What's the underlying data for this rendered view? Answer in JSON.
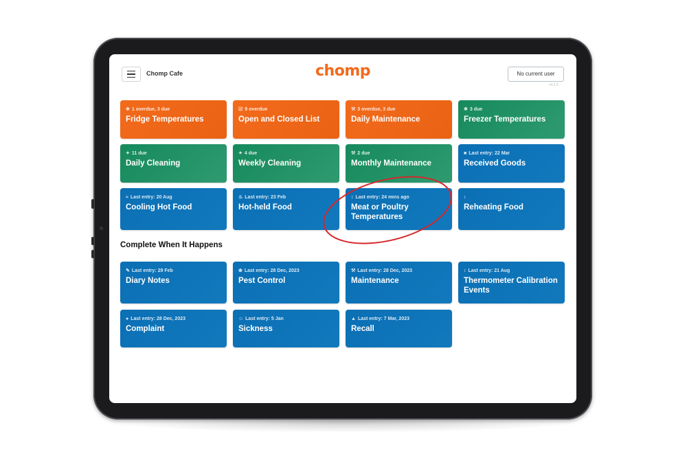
{
  "header": {
    "cafe_name": "Chomp Cafe",
    "logo": "chomp",
    "user_button": "No current user",
    "version": "v4.2.0"
  },
  "colors": {
    "orange": "#f26a1b",
    "green": "#168a5c",
    "blue": "#0b6fb4",
    "annotation": "#d7262a"
  },
  "scheduled_tasks": [
    {
      "status": "1 overdue, 3 due",
      "title": "Fridge Temperatures",
      "icon": "snowflake-icon",
      "color": "orange"
    },
    {
      "status": "9 overdue",
      "title": "Open and Closed List",
      "icon": "checkbox-icon",
      "color": "orange"
    },
    {
      "status": "3 overdue, 3 due",
      "title": "Daily Maintenance",
      "icon": "wrench-icon",
      "color": "orange"
    },
    {
      "status": "3 due",
      "title": "Freezer Temperatures",
      "icon": "snowflake-icon",
      "color": "green"
    },
    {
      "status": "11 due",
      "title": "Daily Cleaning",
      "icon": "sparkle-icon",
      "color": "green"
    },
    {
      "status": "4 due",
      "title": "Weekly Cleaning",
      "icon": "sparkle-icon",
      "color": "green"
    },
    {
      "status": "2 due",
      "title": "Monthly Maintenance",
      "icon": "wrench-icon",
      "color": "green"
    },
    {
      "status": "Last entry: 22 Mar",
      "title": "Received Goods",
      "icon": "truck-icon",
      "color": "blue"
    },
    {
      "status": "Last entry: 20 Aug",
      "title": "Cooling Hot Food",
      "icon": "wind-icon",
      "color": "blue"
    },
    {
      "status": "Last entry: 23 Feb",
      "title": "Hot-held Food",
      "icon": "heat-icon",
      "color": "blue"
    },
    {
      "status": "Last entry: 24 mins ago",
      "title": "Meat or Poultry Temperatures",
      "icon": "thermometer-icon",
      "color": "blue"
    },
    {
      "status": "",
      "title": "Reheating Food",
      "icon": "thermometer-icon",
      "color": "blue"
    }
  ],
  "section_title": "Complete When It Happens",
  "event_tasks": [
    {
      "status": "Last entry: 29 Feb",
      "title": "Diary Notes",
      "icon": "edit-icon",
      "color": "blue"
    },
    {
      "status": "Last entry: 28 Dec, 2023",
      "title": "Pest Control",
      "icon": "paw-icon",
      "color": "blue"
    },
    {
      "status": "Last entry: 28 Dec, 2023",
      "title": "Maintenance",
      "icon": "wrench-icon",
      "color": "blue"
    },
    {
      "status": "Last entry: 21 Aug",
      "title": "Thermometer Calibration Events",
      "icon": "thermometer-icon",
      "color": "blue"
    },
    {
      "status": "Last entry: 28 Dec, 2023",
      "title": "Complaint",
      "icon": "chat-icon",
      "color": "blue"
    },
    {
      "status": "Last entry: 5 Jan",
      "title": "Sickness",
      "icon": "face-icon",
      "color": "blue"
    },
    {
      "status": "Last entry: 7 Mar, 2023",
      "title": "Recall",
      "icon": "warning-icon",
      "color": "blue"
    }
  ]
}
